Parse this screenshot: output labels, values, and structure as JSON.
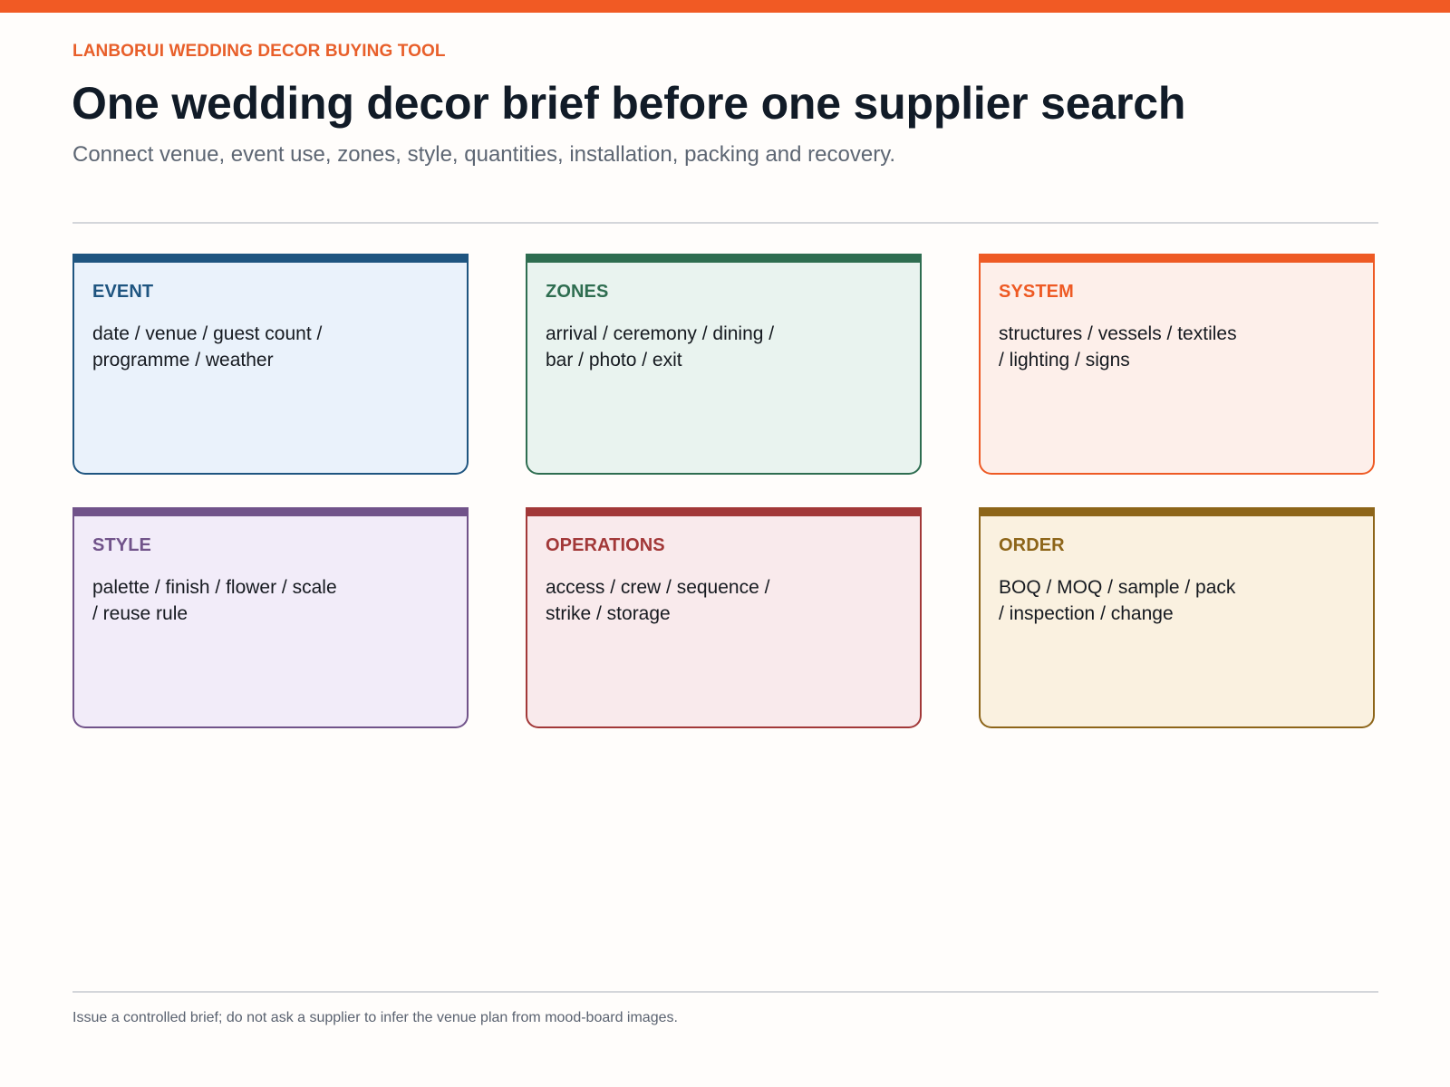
{
  "header": {
    "eyebrow": "LANBORUI WEDDING DECOR BUYING TOOL",
    "title": "One wedding decor brief before one supplier search",
    "subtitle": "Connect venue, event use, zones, style, quantities, installation, packing and recovery."
  },
  "cards": [
    {
      "label": "EVENT",
      "text": "date / venue / guest count / programme / weather",
      "accent_color": "#1f5580",
      "background_color": "#eaf2fb"
    },
    {
      "label": "ZONES",
      "text": "arrival / ceremony / dining / bar / photo / exit",
      "accent_color": "#2e6d50",
      "background_color": "#e9f3ef"
    },
    {
      "label": "SYSTEM",
      "text": "structures / vessels / textiles / lighting / signs",
      "accent_color": "#ee5a24",
      "background_color": "#fdefea"
    },
    {
      "label": "STYLE",
      "text": "palette / finish / flower / scale / reuse rule",
      "accent_color": "#71538a",
      "background_color": "#f2ecf9"
    },
    {
      "label": "OPERATIONS",
      "text": "access / crew / sequence / strike / storage",
      "accent_color": "#a23838",
      "background_color": "#f9eaec"
    },
    {
      "label": "ORDER",
      "text": "BOQ / MOQ / sample / pack / inspection / change",
      "accent_color": "#8d6519",
      "background_color": "#faf1e0"
    }
  ],
  "footer": {
    "note": "Issue a controlled brief; do not ask a supplier to infer the venue plan from mood-board images."
  },
  "theme": {
    "top_bar_color": "#f15a24",
    "eyebrow_color": "#e85f2a"
  }
}
